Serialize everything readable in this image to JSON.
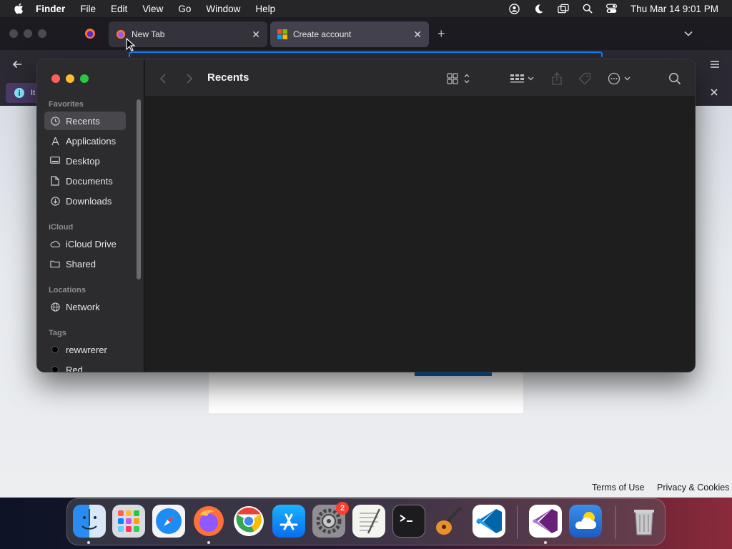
{
  "menubar": {
    "app_name": "Finder",
    "items": [
      "File",
      "Edit",
      "View",
      "Go",
      "Window",
      "Help"
    ],
    "clock": "Thu Mar 14  9:01 PM",
    "status_icons": [
      "user-icon",
      "moon-icon",
      "screen-mirroring-icon",
      "search-icon",
      "control-center-icon"
    ]
  },
  "browser": {
    "tabs": [
      {
        "title": "New Tab",
        "icon": "firefox-icon"
      },
      {
        "title": "Create account",
        "icon": "microsoft-icon"
      }
    ],
    "info_bar_text": "It",
    "footer": {
      "terms": "Terms of Use",
      "privacy": "Privacy & Cookies"
    }
  },
  "finder": {
    "title": "Recents",
    "sidebar": {
      "favorites_label": "Favorites",
      "favorites": [
        {
          "label": "Recents",
          "icon": "clock-icon",
          "selected": true
        },
        {
          "label": "Applications",
          "icon": "applications-icon"
        },
        {
          "label": "Desktop",
          "icon": "desktop-icon"
        },
        {
          "label": "Documents",
          "icon": "document-icon"
        },
        {
          "label": "Downloads",
          "icon": "download-icon"
        }
      ],
      "icloud_label": "iCloud",
      "icloud": [
        {
          "label": "iCloud Drive",
          "icon": "cloud-icon"
        },
        {
          "label": "Shared",
          "icon": "shared-folder-icon"
        }
      ],
      "locations_label": "Locations",
      "locations": [
        {
          "label": "Network",
          "icon": "globe-icon"
        }
      ],
      "tags_label": "Tags",
      "tags": [
        {
          "label": "rewwrerer"
        },
        {
          "label": "Red"
        }
      ]
    }
  },
  "dock": {
    "apps": [
      "Finder",
      "Launchpad",
      "Safari",
      "Firefox",
      "Google Chrome",
      "App Store",
      "System Settings",
      "TextEdit",
      "Terminal",
      "GarageBand",
      "Visual Studio Code",
      "Visual Studio",
      "Weather",
      "Trash"
    ],
    "system_settings_badge": "2"
  },
  "colors": {
    "accent": "#0a84ff",
    "finder_bg": "#1e1e1e",
    "sidebar_bg": "#2c2c2e",
    "selected_bg": "#48484c"
  }
}
